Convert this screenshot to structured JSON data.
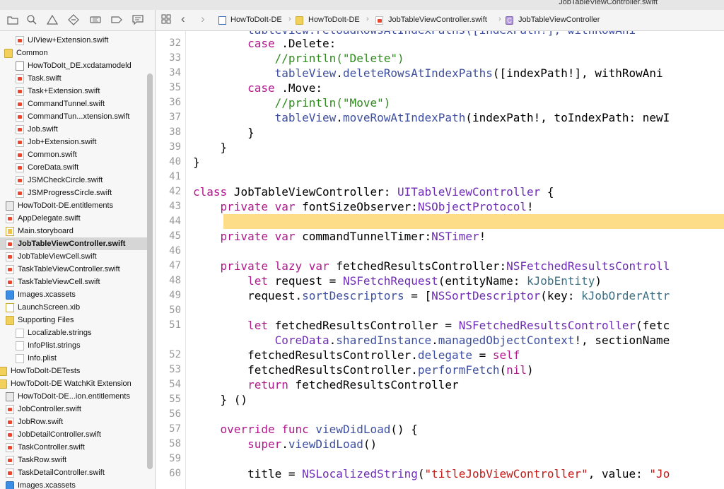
{
  "window": {
    "title": "JobTableViewController.swift"
  },
  "jumpbar": {
    "crumbs": [
      "HowToDoIt-DE",
      "HowToDoIt-DE",
      "JobTableViewController.swift",
      "JobTableViewController"
    ],
    "back": "‹",
    "forward": "›"
  },
  "navigator": {
    "items": [
      {
        "label": "UIView+Extension.swift",
        "icon": "swift-file-icon"
      },
      {
        "label": "Common",
        "icon": "folder-icon"
      },
      {
        "label": "HowToDoIt_DE.xcdatamodeld",
        "icon": "datamodel-icon"
      },
      {
        "label": "Task.swift",
        "icon": "swift-file-icon"
      },
      {
        "label": "Task+Extension.swift",
        "icon": "swift-file-icon"
      },
      {
        "label": "CommandTunnel.swift",
        "icon": "swift-file-icon"
      },
      {
        "label": "CommandTun...xtension.swift",
        "icon": "swift-file-icon"
      },
      {
        "label": "Job.swift",
        "icon": "swift-file-icon"
      },
      {
        "label": "Job+Extension.swift",
        "icon": "swift-file-icon"
      },
      {
        "label": "Common.swift",
        "icon": "swift-file-icon"
      },
      {
        "label": "CoreData.swift",
        "icon": "swift-file-icon"
      },
      {
        "label": "JSMCheckCircle.swift",
        "icon": "swift-file-icon"
      },
      {
        "label": "JSMProgressCircle.swift",
        "icon": "swift-file-icon"
      },
      {
        "label": "HowToDoIt-DE.entitlements",
        "icon": "entitlements-icon"
      },
      {
        "label": "AppDelegate.swift",
        "icon": "swift-file-icon"
      },
      {
        "label": "Main.storyboard",
        "icon": "storyboard-icon"
      },
      {
        "label": "JobTableViewController.swift",
        "icon": "swift-file-icon",
        "selected": true
      },
      {
        "label": "JobTableViewCell.swift",
        "icon": "swift-file-icon"
      },
      {
        "label": "TaskTableViewController.swift",
        "icon": "swift-file-icon"
      },
      {
        "label": "TaskTableViewCell.swift",
        "icon": "swift-file-icon"
      },
      {
        "label": "Images.xcassets",
        "icon": "asset-catalog-icon"
      },
      {
        "label": "LaunchScreen.xib",
        "icon": "xib-icon"
      },
      {
        "label": "Supporting Files",
        "icon": "folder-icon"
      },
      {
        "label": "Localizable.strings",
        "icon": "strings-file-icon"
      },
      {
        "label": "InfoPlist.strings",
        "icon": "strings-file-icon"
      },
      {
        "label": "Info.plist",
        "icon": "plist-file-icon"
      },
      {
        "label": "HowToDoIt-DETests",
        "icon": "folder-icon"
      },
      {
        "label": "HowToDoIt-DE WatchKit Extension",
        "icon": "folder-icon"
      },
      {
        "label": "HowToDoIt-DE...ion.entitlements",
        "icon": "entitlements-icon"
      },
      {
        "label": "JobController.swift",
        "icon": "swift-file-icon"
      },
      {
        "label": "JobRow.swift",
        "icon": "swift-file-icon"
      },
      {
        "label": "JobDetailController.swift",
        "icon": "swift-file-icon"
      },
      {
        "label": "TaskController.swift",
        "icon": "swift-file-icon"
      },
      {
        "label": "TaskRow.swift",
        "icon": "swift-file-icon"
      },
      {
        "label": "TaskDetailController.swift",
        "icon": "swift-file-icon"
      },
      {
        "label": "Images.xcassets",
        "icon": "asset-catalog-icon"
      }
    ]
  },
  "editor": {
    "current_line": 44,
    "lines": [
      {
        "n": "32",
        "code": "        case .Delete:"
      },
      {
        "n": "33",
        "code": "            //println(\"Delete\")"
      },
      {
        "n": "34",
        "code": "            tableView.deleteRowsAtIndexPaths([indexPath!], withRowAni"
      },
      {
        "n": "35",
        "code": "        case .Move:"
      },
      {
        "n": "36",
        "code": "            //println(\"Move\")"
      },
      {
        "n": "37",
        "code": "            tableView.moveRowAtIndexPath(indexPath!, toIndexPath: newI"
      },
      {
        "n": "38",
        "code": "        }"
      },
      {
        "n": "39",
        "code": "    }"
      },
      {
        "n": "40",
        "code": "}"
      },
      {
        "n": "41",
        "code": ""
      },
      {
        "n": "42",
        "code": "class JobTableViewController: UITableViewController {"
      },
      {
        "n": "43",
        "code": "    private var fontSizeObserver:NSObjectProtocol!"
      },
      {
        "n": "44",
        "code": ""
      },
      {
        "n": "45",
        "code": "    private var commandTunnelTimer:NSTimer!"
      },
      {
        "n": "46",
        "code": ""
      },
      {
        "n": "47",
        "code": "    private lazy var fetchedResultsController:NSFetchedResultsControll"
      },
      {
        "n": "48",
        "code": "        let request = NSFetchRequest(entityName: kJobEntity)"
      },
      {
        "n": "49",
        "code": "        request.sortDescriptors = [NSSortDescriptor(key: kJobOrderAttr"
      },
      {
        "n": "50",
        "code": ""
      },
      {
        "n": "51",
        "code": "        let fetchedResultsController = NSFetchedResultsController(fetc"
      },
      {
        "n": "",
        "code": "            CoreData.sharedInstance.managedObjectContext!, sectionName"
      },
      {
        "n": "52",
        "code": "        fetchedResultsController.delegate = self"
      },
      {
        "n": "53",
        "code": "        fetchedResultsController.performFetch(nil)"
      },
      {
        "n": "54",
        "code": "        return fetchedResultsController"
      },
      {
        "n": "55",
        "code": "    } ()"
      },
      {
        "n": "56",
        "code": ""
      },
      {
        "n": "57",
        "code": "    override func viewDidLoad() {"
      },
      {
        "n": "58",
        "code": "        super.viewDidLoad()"
      },
      {
        "n": "59",
        "code": ""
      },
      {
        "n": "60",
        "code": "        title = NSLocalizedString(\"titleJobViewController\", value: \"Jo"
      }
    ]
  }
}
